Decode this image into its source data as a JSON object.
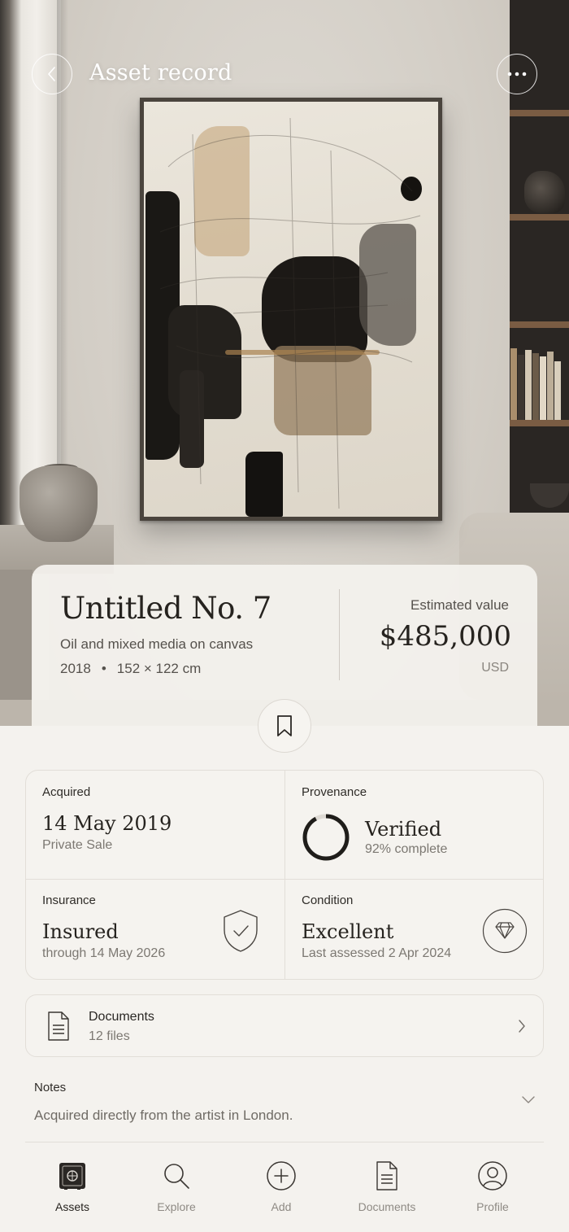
{
  "header": {
    "title": "Asset record",
    "back_icon": "chevron-left-icon",
    "more_icon": "more-horizontal-icon"
  },
  "artwork": {
    "title": "Untitled No. 7",
    "medium": "Oil and mixed media on canvas",
    "year": "2018",
    "separator": "•",
    "dimensions": "152 × 122 cm",
    "value_label": "Estimated value",
    "value": "$485,000",
    "currency": "USD"
  },
  "stats": {
    "acquired": {
      "label": "Acquired",
      "value": "14 May 2019",
      "sub": "Private Sale"
    },
    "provenance": {
      "label": "Provenance",
      "value": "Verified",
      "sub": "92% complete",
      "progress": 0.92
    },
    "insurance": {
      "label": "Insurance",
      "value": "Insured",
      "sub": "through 14 May 2026",
      "icon": "shield-check-icon"
    },
    "condition": {
      "label": "Condition",
      "value": "Excellent",
      "sub": "Last assessed 2 Apr 2024",
      "icon": "diamond-icon"
    }
  },
  "documents": {
    "title": "Documents",
    "count": "12 files"
  },
  "notes": {
    "label": "Notes",
    "text": "Acquired directly from the artist in London."
  },
  "tabs": [
    {
      "label": "Assets",
      "icon": "safe-icon",
      "active": true
    },
    {
      "label": "Explore",
      "icon": "search-icon",
      "active": false
    },
    {
      "label": "Add",
      "icon": "plus-circle-icon",
      "active": false
    },
    {
      "label": "Documents",
      "icon": "document-icon",
      "active": false
    },
    {
      "label": "Profile",
      "icon": "user-icon",
      "active": false
    }
  ],
  "colors": {
    "background": "#f4f2ee",
    "text": "#26231f",
    "muted": "#7c7872",
    "border": "#e2ded8"
  }
}
